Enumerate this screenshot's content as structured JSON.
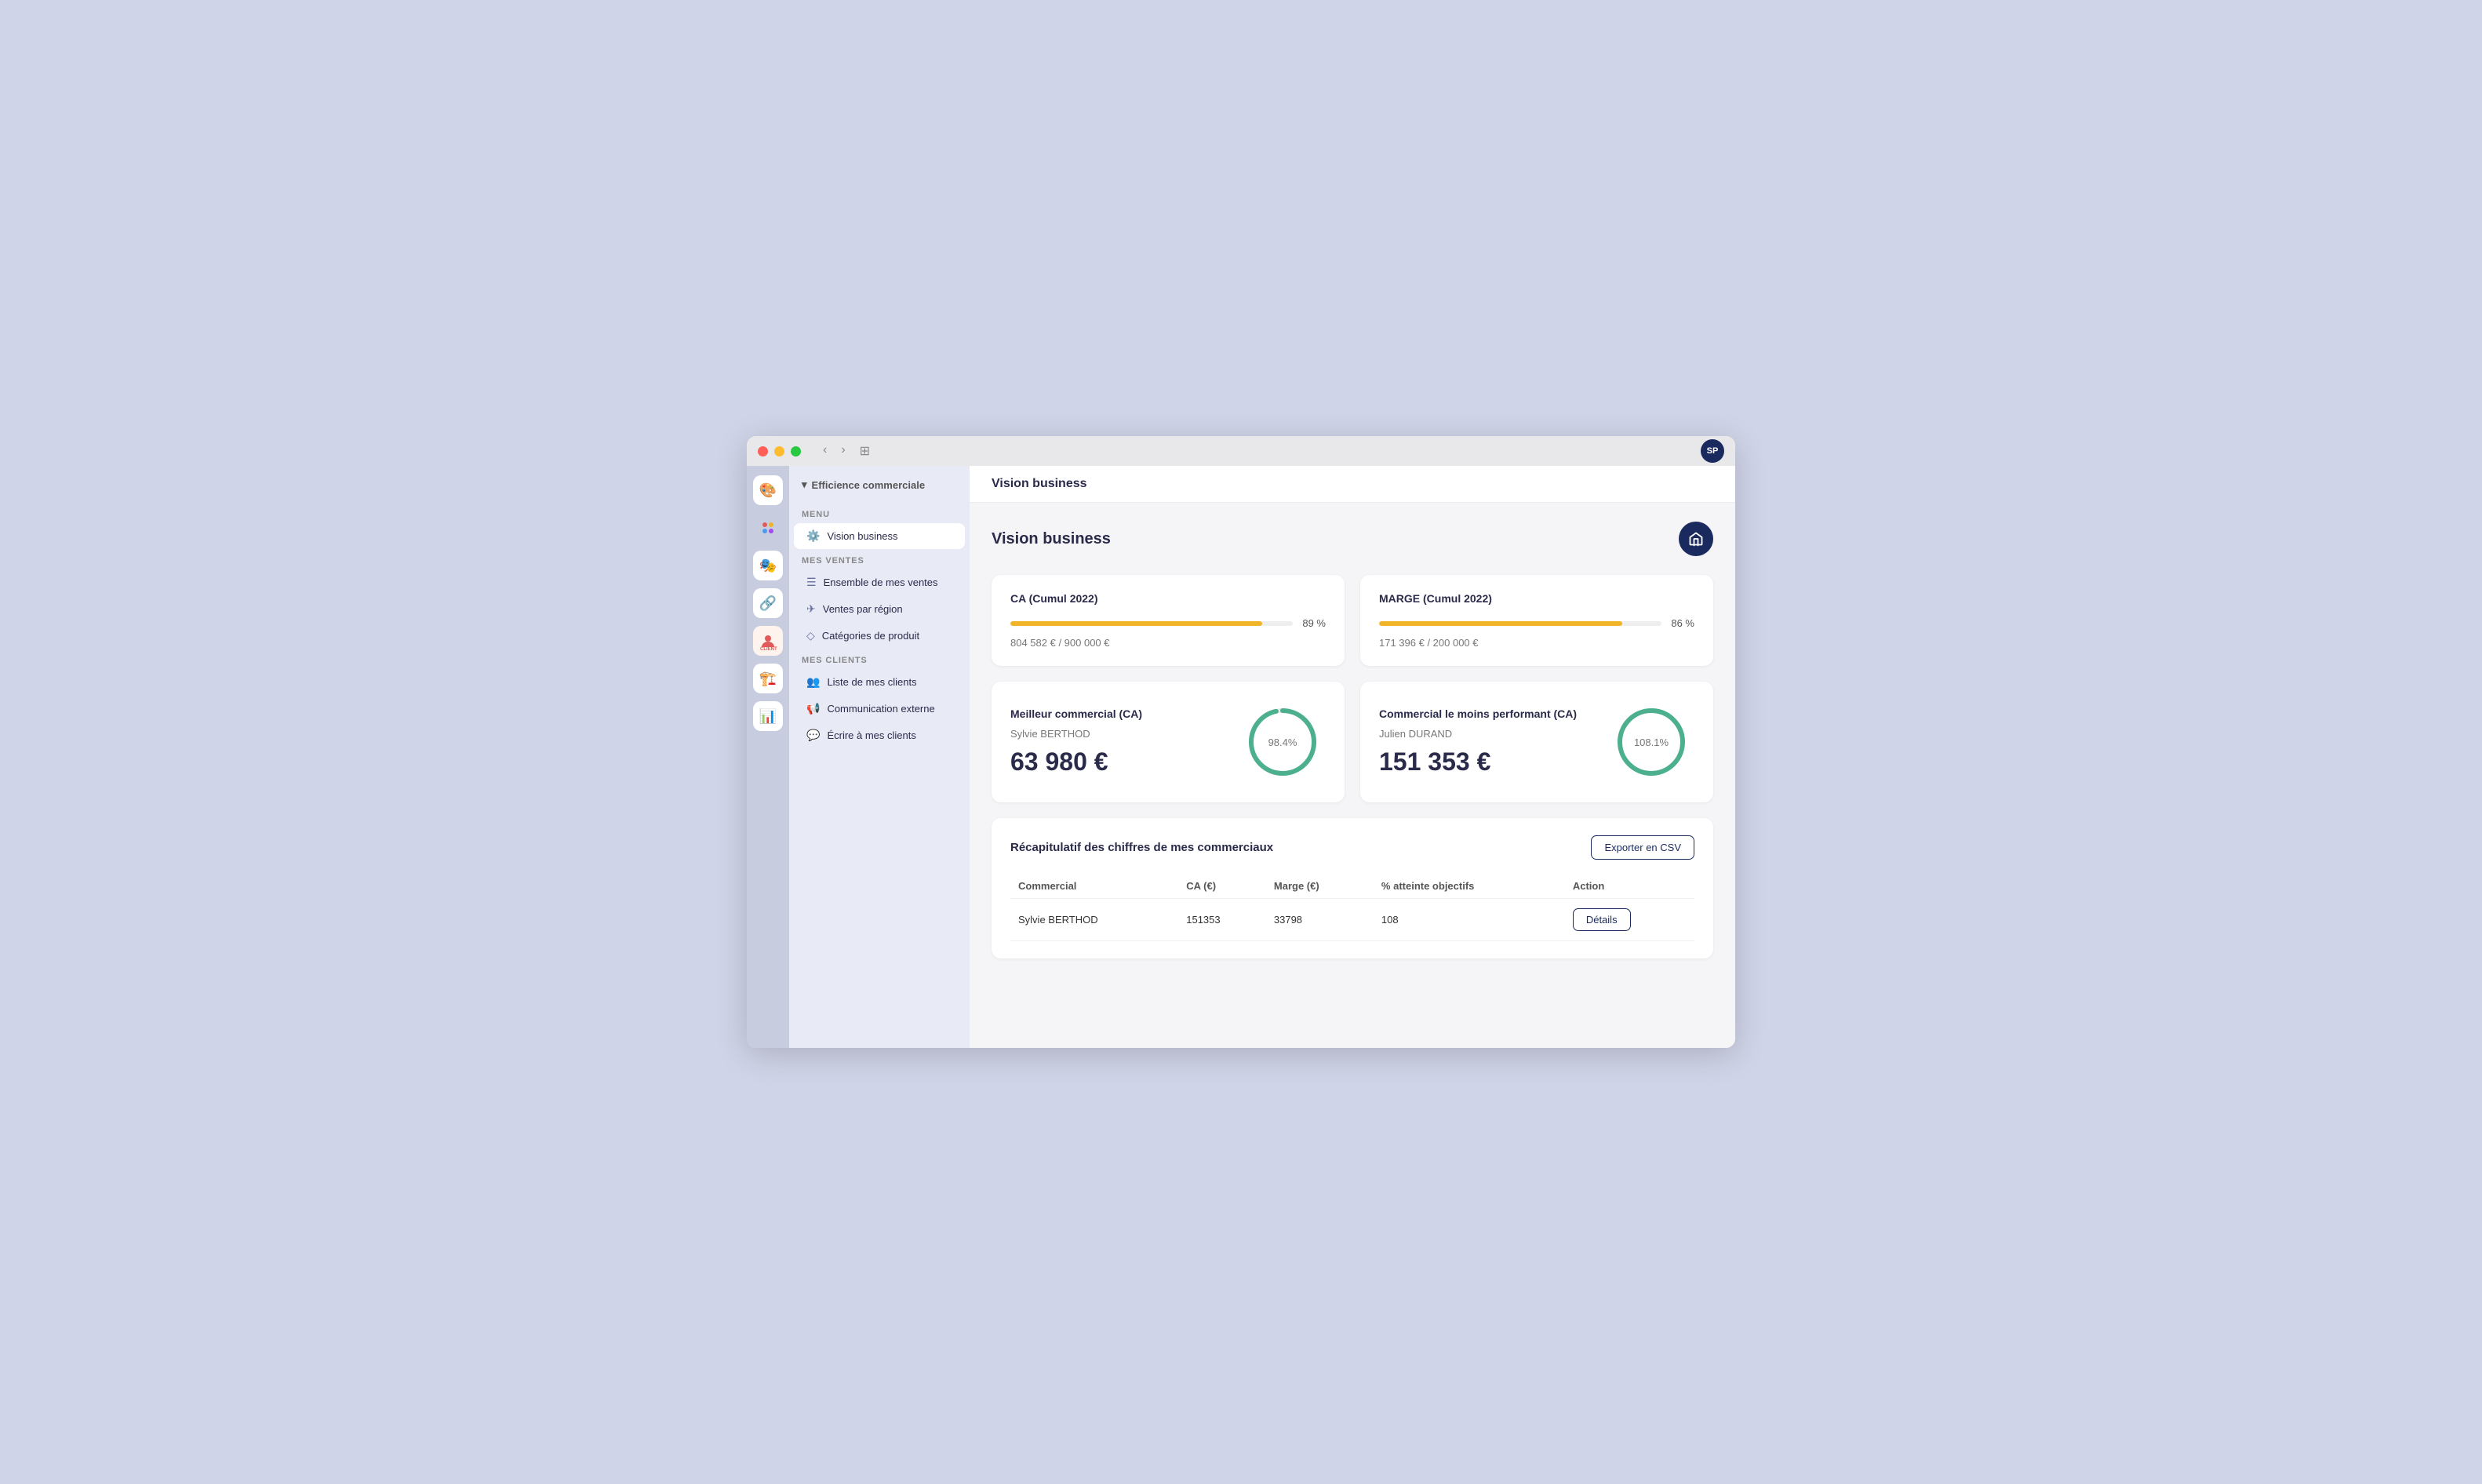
{
  "window": {
    "title": "Efficience commerciale"
  },
  "titlebar": {
    "user_initials": "SP"
  },
  "sidebar": {
    "app_name": "Efficience commerciale",
    "sections": [
      {
        "label": "MENU",
        "items": [
          {
            "id": "vision-business",
            "icon": "⚙️",
            "label": "Vision business",
            "active": true
          }
        ]
      },
      {
        "label": "MES VENTES",
        "items": [
          {
            "id": "ensemble-ventes",
            "icon": "☰",
            "label": "Ensemble de mes ventes",
            "active": false
          },
          {
            "id": "ventes-region",
            "icon": "✈",
            "label": "Ventes par région",
            "active": false
          },
          {
            "id": "categories-produit",
            "icon": "◇",
            "label": "Catégories de produit",
            "active": false
          }
        ]
      },
      {
        "label": "MES CLIENTS",
        "items": [
          {
            "id": "liste-clients",
            "icon": "👥",
            "label": "Liste de mes clients",
            "active": false
          },
          {
            "id": "communication",
            "icon": "📢",
            "label": "Communication externe",
            "active": false
          },
          {
            "id": "ecrire-clients",
            "icon": "💬",
            "label": "Écrire à mes clients",
            "active": false
          }
        ]
      }
    ]
  },
  "page": {
    "header": "Vision business",
    "title": "Vision business",
    "cards": {
      "ca": {
        "title": "CA (Cumul 2022)",
        "progress": 89,
        "progress_label": "89 %",
        "values": "804 582 € / 900 000 €"
      },
      "marge": {
        "title": "MARGE (Cumul 2022)",
        "progress": 86,
        "progress_label": "86 %",
        "values": "171 396 € / 200 000 €"
      },
      "best_commercial": {
        "title": "Meilleur commercial (CA)",
        "name": "Sylvie BERTHOD",
        "value": "63 980 €",
        "gauge_pct": 98.4,
        "gauge_label": "98.4%"
      },
      "worst_commercial": {
        "title": "Commercial le moins performant (CA)",
        "name": "Julien DURAND",
        "value": "151 353 €",
        "gauge_pct": 108.1,
        "gauge_label": "108.1%"
      }
    },
    "table": {
      "title": "Récapitulatif des chiffres de mes commerciaux",
      "export_btn": "Exporter en CSV",
      "columns": [
        "Commercial",
        "CA (€)",
        "Marge (€)",
        "% atteinte objectifs",
        "Action"
      ],
      "rows": [
        {
          "commercial": "Sylvie BERTHOD",
          "ca": "151353",
          "marge": "33798",
          "pct": "108",
          "action": "Détails"
        }
      ]
    }
  },
  "rail_icons": [
    "🎨",
    "⬛",
    "🎭",
    "🔗",
    "👥",
    "🏗️",
    "📊"
  ],
  "colors": {
    "progress_fill": "#f0b429",
    "gauge_stroke": "#4caf8e",
    "sidebar_active_bg": "#ffffff",
    "sidebar_bg": "#e8eaf6",
    "home_btn_bg": "#1a2a5e"
  }
}
